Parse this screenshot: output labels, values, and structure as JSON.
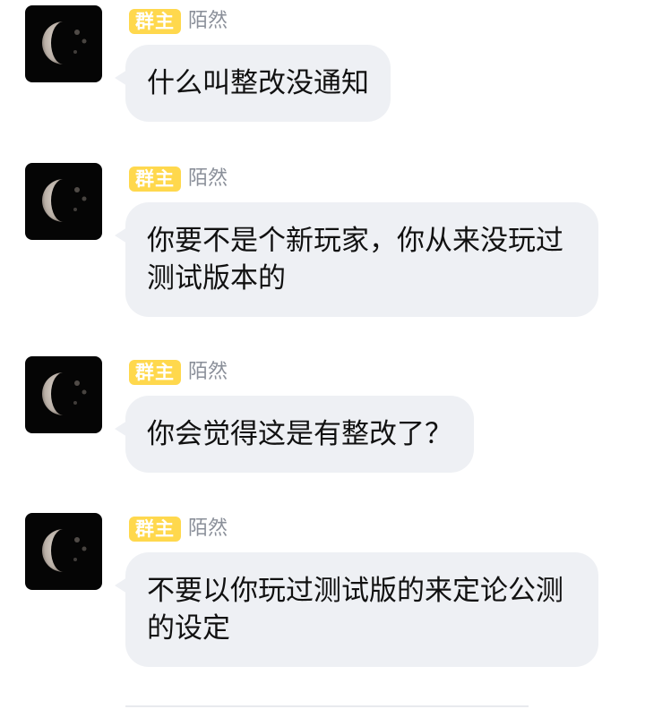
{
  "messages": [
    {
      "badge": "群主",
      "sender": "陌然",
      "text": "什么叫整改没通知"
    },
    {
      "badge": "群主",
      "sender": "陌然",
      "text": "你要不是个新玩家，你从来没玩过测试版本的"
    },
    {
      "badge": "群主",
      "sender": "陌然",
      "text": "你会觉得这是有整改了？"
    },
    {
      "badge": "群主",
      "sender": "陌然",
      "text": "不要以你玩过测试版的来定论公测的设定"
    }
  ],
  "avatar": {
    "icon": "half-moon-icon",
    "background_color": "#050505",
    "moon_color": "#c9c1b8"
  },
  "colors": {
    "badge_bg": "#ffd84d",
    "bubble_bg": "#eef0f4",
    "sender_text": "#8a8f99"
  }
}
